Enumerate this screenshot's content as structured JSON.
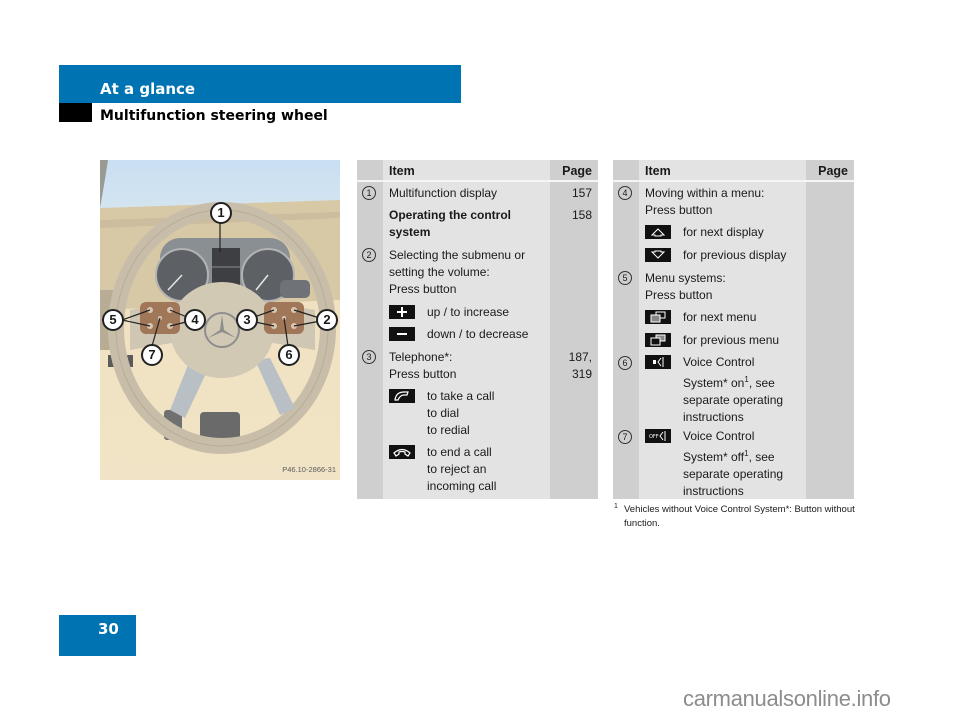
{
  "header": {
    "section": "At a glance",
    "subsection": "Multifunction steering wheel"
  },
  "page_number": "30",
  "watermark": "carmanualsonline.info",
  "illustration": {
    "code": "P46.10-2866-31",
    "callouts": [
      "1",
      "2",
      "3",
      "4",
      "5",
      "6",
      "7"
    ]
  },
  "table_left": {
    "headers": {
      "item": "Item",
      "page": "Page"
    },
    "rows": {
      "r1": {
        "num": "1",
        "text": "Multifunction display",
        "page": "157"
      },
      "r1b": {
        "text_line1": "Operating the control",
        "text_line2": "system",
        "page": "158"
      },
      "r2": {
        "num": "2",
        "line1": "Selecting the submenu or",
        "line2": "setting the volume:",
        "line3": "Press button",
        "buttons": [
          {
            "icon": "plus-icon",
            "label": "up / to increase"
          },
          {
            "icon": "minus-icon",
            "label": "down / to decrease"
          }
        ]
      },
      "r3": {
        "num": "3",
        "line1": "Telephone*:",
        "line2": "Press button",
        "page_line1": "187,",
        "page_line2": "319",
        "buttons": [
          {
            "icon": "phone-pickup-icon",
            "label_lines": [
              "to take a call",
              "to dial",
              "to redial"
            ]
          },
          {
            "icon": "phone-hangup-icon",
            "label_lines": [
              "to end a call",
              "to reject an",
              "incoming call"
            ]
          }
        ]
      }
    }
  },
  "table_right": {
    "headers": {
      "item": "Item",
      "page": "Page"
    },
    "rows": {
      "r4": {
        "num": "4",
        "line1": "Moving within a menu:",
        "line2": "Press button",
        "buttons": [
          {
            "icon": "arrow-up-icon",
            "label": "for next display"
          },
          {
            "icon": "arrow-down-icon",
            "label": "for previous display"
          }
        ]
      },
      "r5": {
        "num": "5",
        "line1": "Menu systems:",
        "line2": "Press button",
        "buttons": [
          {
            "icon": "next-menu-icon",
            "label": "for next menu"
          },
          {
            "icon": "previous-menu-icon",
            "label": "for previous menu"
          }
        ]
      },
      "r6": {
        "num": "6",
        "icon": "voice-control-on-icon",
        "lines": [
          "Voice Control",
          "System* on",
          "separate operating",
          "instructions"
        ],
        "sup": "1",
        "after_sup": ", see"
      },
      "r7": {
        "num": "7",
        "icon": "voice-control-off-icon",
        "lines": [
          "Voice Control",
          "System* off",
          "separate operating",
          "instructions"
        ],
        "sup": "1",
        "after_sup": ", see"
      }
    }
  },
  "footnote": {
    "marker": "1",
    "text": "Vehicles without Voice Control System*: Button without function."
  }
}
